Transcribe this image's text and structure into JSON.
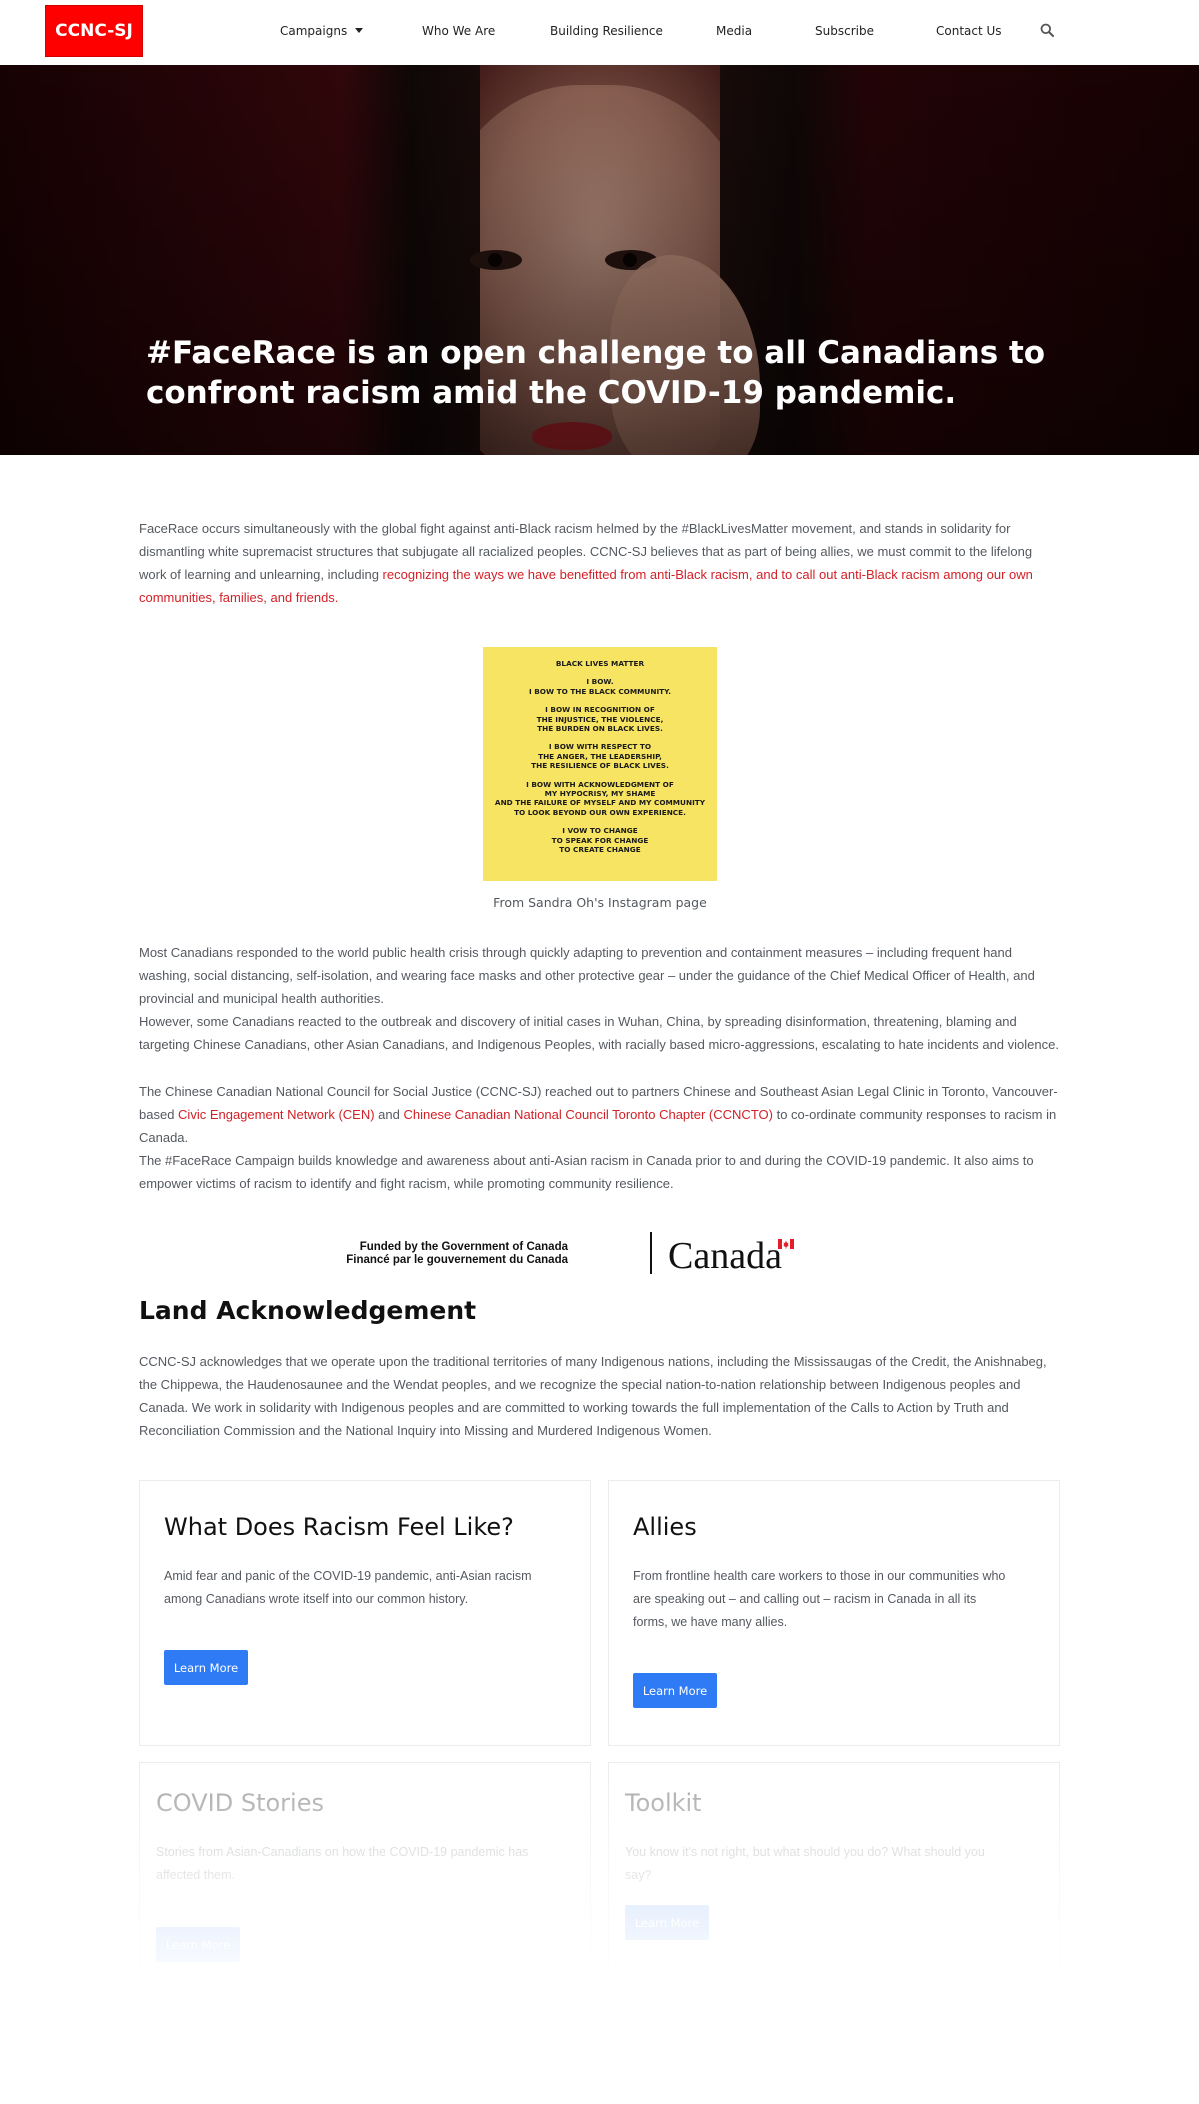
{
  "header": {
    "logo": "CCNC-SJ",
    "nav": [
      "Campaigns",
      "Who We Are",
      "Building Resilience",
      "Media",
      "Subscribe",
      "Contact Us"
    ]
  },
  "hero": {
    "title": "#FaceRace is an open challenge to all Canadians to confront racism amid the COVID-19 pandemic."
  },
  "intro": {
    "text": "FaceRace occurs simultaneously with the global fight against anti-Black racism helmed by the #BlackLivesMatter movement, and stands in solidarity for dismantling white supremacist structures that subjugate all racialized peoples. CCNC-SJ believes that as part of being allies, we must commit to the lifelong work of learning and unlearning, including ",
    "link": "recognizing the ways we have benefitted from anti-Black racism, and to call out anti-Black racism among our own communities, families, and friends."
  },
  "blm": {
    "lines": [
      [
        "BLACK LIVES MATTER"
      ],
      [
        "I BOW.",
        "I BOW TO THE BLACK COMMUNITY."
      ],
      [
        "I BOW IN RECOGNITION OF",
        "THE INJUSTICE, THE VIOLENCE,",
        "THE BURDEN ON BLACK LIVES."
      ],
      [
        "I BOW WITH RESPECT TO",
        "THE ANGER, THE LEADERSHIP,",
        "THE RESILIENCE OF BLACK LIVES."
      ],
      [
        "I BOW WITH ACKNOWLEDGMENT OF",
        "MY HYPOCRISY, MY SHAME",
        "AND THE FAILURE OF MYSELF AND MY COMMUNITY",
        "TO LOOK BEYOND OUR OWN EXPERIENCE."
      ],
      [
        "I VOW TO CHANGE",
        "TO SPEAK FOR CHANGE",
        "TO CREATE CHANGE"
      ]
    ],
    "caption": "From Sandra Oh's Instagram page"
  },
  "body": {
    "p1": "Most Canadians responded to the world public health crisis through quickly adapting to prevention and containment measures – including frequent hand washing, social distancing, self-isolation, and wearing face masks and other protective gear – under the guidance of the Chief Medical Officer of Health, and provincial and municipal health authorities.",
    "p2": "However, some Canadians reacted to the outbreak and discovery of initial cases in Wuhan, China, by spreading disinformation, threatening, blaming and targeting Chinese Canadians, other Asian Canadians, and Indigenous Peoples, with racially based micro-aggressions, escalating to hate incidents and violence.",
    "p3_a": "The Chinese Canadian National Council for Social Justice (CCNC-SJ) reached out to partners Chinese and Southeast Asian Legal Clinic in Toronto, Vancouver-based ",
    "p3_link1": "Civic Engagement Network (CEN)",
    "p3_b": " and ",
    "p3_link2": "Chinese Canadian National Council Toronto Chapter (CCNCTO)",
    "p3_c": " to co-ordinate community responses to racism in Canada.",
    "p4": "The #FaceRace Campaign builds knowledge and awareness about anti-Asian racism in Canada prior to and during the COVID-19 pandemic. It also aims to empower victims of racism to identify and fight racism, while promoting community resilience."
  },
  "funded": {
    "en": "Funded by the Government of Canada",
    "fr": "Financé par le gouvernement du Canada",
    "wordmark": "Canada"
  },
  "land": {
    "heading": "Land Acknowledgement",
    "text": "CCNC-SJ acknowledges that we operate upon the traditional territories of many Indigenous nations, including the Mississaugas of the Credit, the Anishnabeg, the Chippewa, the Haudenosaunee and the Wendat peoples, and we recognize the special nation-to-nation relationship between Indigenous peoples and Canada. We work in solidarity with Indigenous peoples and are committed to working towards the full implementation of the Calls to Action by Truth and Reconciliation Commission and the National Inquiry into Missing and Murdered Indigenous Women."
  },
  "cards": [
    {
      "title": "What Does Racism Feel Like?",
      "text": "Amid fear and panic of the COVID-19 pandemic, anti-Asian racism among Canadians wrote itself into our common history.",
      "button": "Learn More"
    },
    {
      "title": "Allies",
      "text": "From frontline health care workers to those in our communities who are speaking out – and calling out – racism in Canada in all its forms, we have many allies.",
      "button": "Learn More"
    },
    {
      "title": "COVID Stories",
      "text": "Stories from Asian-Canadians on how the COVID-19 pandemic has affected them.",
      "button": "Learn More"
    },
    {
      "title": "Toolkit",
      "text": "You know it's not right, but what should you do? What should you say?",
      "button": "Learn More"
    }
  ],
  "colors": {
    "brand_red": "#ff0000",
    "link_red": "#d32027",
    "button_blue": "#2e7bf5"
  }
}
